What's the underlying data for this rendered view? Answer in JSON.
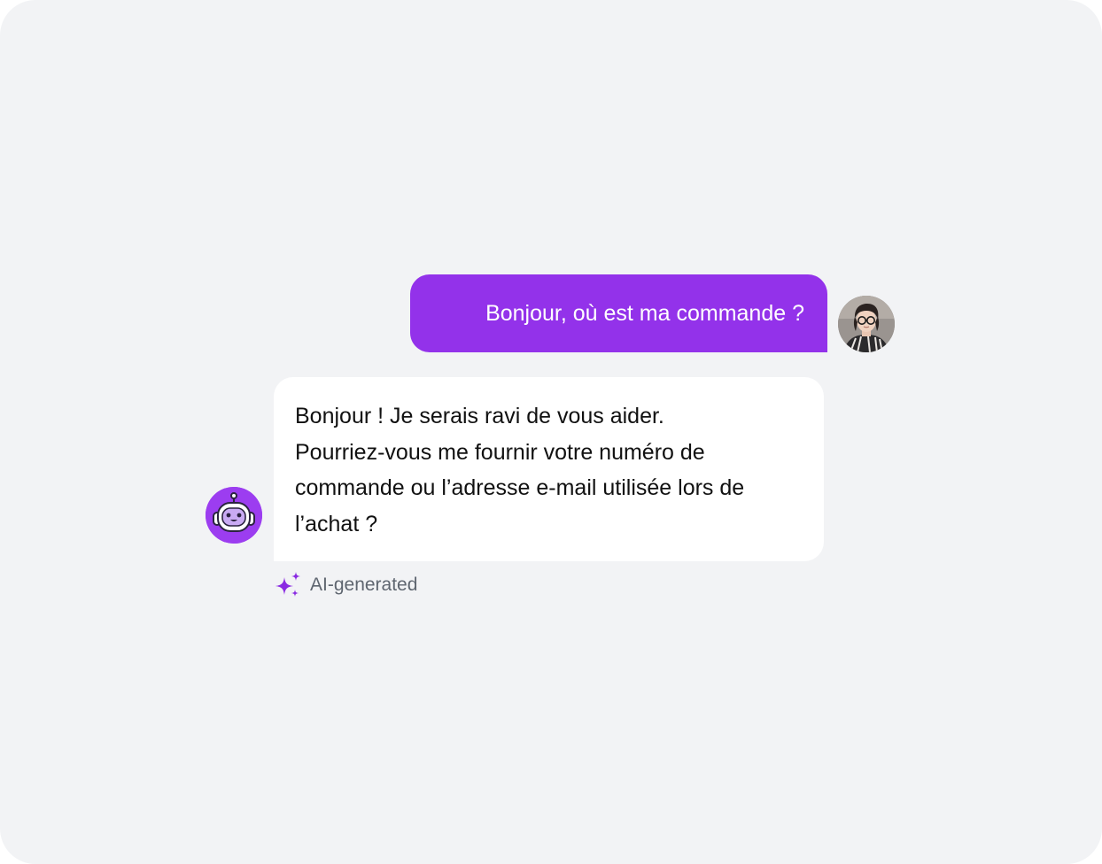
{
  "colors": {
    "background": "#f2f3f5",
    "user_bubble": "#9332ea",
    "bot_bubble": "#ffffff",
    "accent": "#9c3df0",
    "ai_label": "#5f6670"
  },
  "messages": {
    "user": {
      "text": "Bonjour, où est ma commande ?",
      "avatar_icon": "user-photo-avatar"
    },
    "bot": {
      "lines": [
        "Bonjour ! Je serais ravi de vous aider.",
        "Pourriez-vous me fournir votre numéro de",
        "commande ou l’adresse e-mail utilisée lors de",
        "l’achat ?"
      ],
      "avatar_icon": "robot-icon"
    }
  },
  "ai_tag": {
    "label": "AI-generated",
    "icon": "sparkles-icon"
  }
}
